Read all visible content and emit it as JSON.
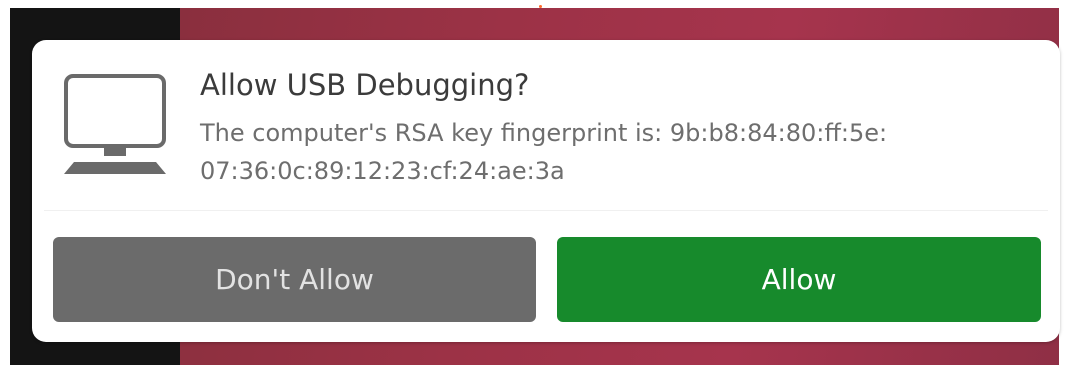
{
  "dialog": {
    "title": "Allow USB Debugging?",
    "message_line1": "The computer's RSA key fingerprint is: 9b:b8:84:80:ff:5e:",
    "message_line2": "07:36:0c:89:12:23:cf:24:ae:3a",
    "icon": "computer-icon",
    "buttons": {
      "deny_label": "Don't Allow",
      "allow_label": "Allow"
    }
  },
  "colors": {
    "deny_button": "#6b6b6b",
    "allow_button": "#178a2c",
    "wallpaper": "#9c3246",
    "dialog_background": "#ffffff"
  }
}
